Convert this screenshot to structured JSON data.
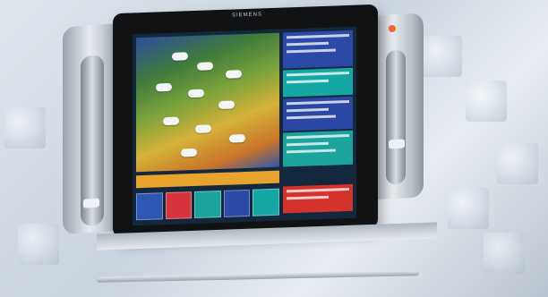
{
  "photo": {
    "subject": "tablet-device",
    "brand_text": "SIEMENS",
    "colors": {
      "background": "#d3dbe4",
      "bezel": "#101214",
      "map_land": "#7aa23c",
      "accent_orange": "#e8a32c",
      "panel_blue": "#2b4aa8",
      "panel_teal": "#14a7a4",
      "panel_red": "#d4332c",
      "led": "#f06a34"
    }
  }
}
